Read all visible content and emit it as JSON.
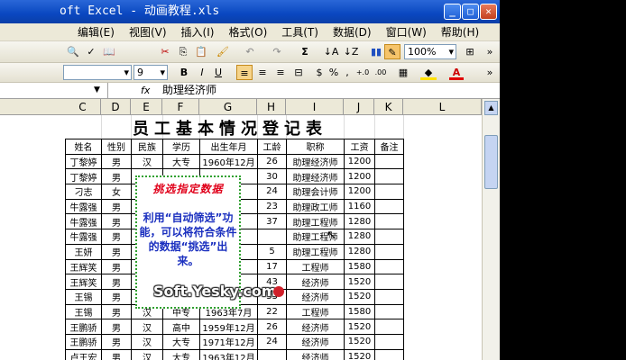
{
  "window": {
    "title": "oft Excel - 动画教程.xls"
  },
  "menu": [
    "编辑(E)",
    "视图(V)",
    "插入(I)",
    "格式(O)",
    "工具(T)",
    "数据(D)",
    "窗口(W)",
    "帮助(H)"
  ],
  "toolbar": {
    "zoom": "100%",
    "sigma": "Σ",
    "font_size": "9",
    "bold": "B",
    "italic": "I",
    "underline": "U",
    "percent": "%",
    "comma": ",",
    "inc_dec": "+.0",
    "dec_dec": ".00"
  },
  "formula_bar": {
    "fx": "fx",
    "content": "助理经济师"
  },
  "columns": [
    "C",
    "D",
    "E",
    "F",
    "G",
    "H",
    "I",
    "J",
    "K",
    "L"
  ],
  "sheet": {
    "title": "员工基本情况登记表",
    "headers": [
      "姓名",
      "性别",
      "民族",
      "学历",
      "出生年月",
      "工龄",
      "职称",
      "工资",
      "备注"
    ],
    "rows": [
      [
        "丁黎婷",
        "男",
        "汉",
        "大专",
        "1960年12月",
        "26",
        "助理经济师",
        "1200",
        ""
      ],
      [
        "丁黎婷",
        "男",
        "",
        "",
        "",
        "30",
        "助理经济师",
        "1200",
        ""
      ],
      [
        "刁志",
        "女",
        "",
        "",
        "",
        "24",
        "助理会计师",
        "1200",
        ""
      ],
      [
        "牛露强",
        "男",
        "",
        "",
        "",
        "23",
        "助理政工师",
        "1160",
        ""
      ],
      [
        "牛露强",
        "男",
        "",
        "",
        "",
        "37",
        "助理工程师",
        "1280",
        ""
      ],
      [
        "牛露强",
        "男",
        "",
        "",
        "",
        "",
        "助理工程师",
        "1280",
        ""
      ],
      [
        "王妍",
        "男",
        "",
        "",
        "",
        "5",
        "助理工程师",
        "1280",
        ""
      ],
      [
        "王辉笑",
        "男",
        "",
        "",
        "",
        "17",
        "工程师",
        "1580",
        ""
      ],
      [
        "王辉笑",
        "男",
        "",
        "",
        "",
        "43",
        "经济师",
        "1520",
        ""
      ],
      [
        "王锡",
        "男",
        "",
        "",
        "",
        "33",
        "经济师",
        "1520",
        ""
      ],
      [
        "王锡",
        "男",
        "汉",
        "中专",
        "1963年7月",
        "22",
        "工程师",
        "1580",
        ""
      ],
      [
        "王鹏骄",
        "男",
        "汉",
        "高中",
        "1959年12月",
        "26",
        "经济师",
        "1520",
        ""
      ],
      [
        "王鹏骄",
        "男",
        "汉",
        "大专",
        "1971年12月",
        "24",
        "经济师",
        "1520",
        ""
      ],
      [
        "卢王宏",
        "男",
        "汉",
        "大专",
        "1963年12月",
        "",
        "经济师",
        "1520",
        ""
      ]
    ]
  },
  "callout": {
    "heading": "挑选指定数据",
    "body": "利用“自动筛选”功能，可以将符合条件的数据“挑选”出来。"
  },
  "watermark": "Soft.Yesky.com"
}
